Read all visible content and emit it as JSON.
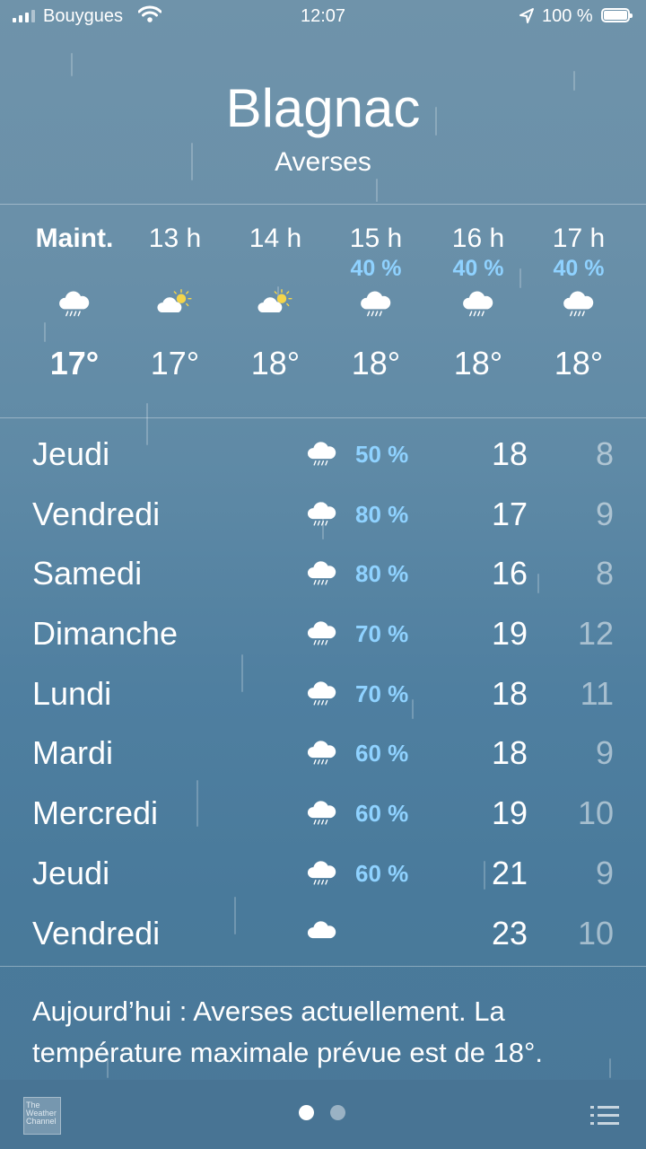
{
  "status_bar": {
    "carrier": "Bouygues",
    "time": "12:07",
    "battery": "100 %"
  },
  "location": {
    "city": "Blagnac",
    "condition": "Averses"
  },
  "hourly": [
    {
      "label": "Maint.",
      "pop": "",
      "icon": "rain-cloud-icon",
      "temp": "17°"
    },
    {
      "label": "13 h",
      "pop": "",
      "icon": "sun-cloud-icon",
      "temp": "17°"
    },
    {
      "label": "14 h",
      "pop": "",
      "icon": "sun-cloud-icon",
      "temp": "18°"
    },
    {
      "label": "15 h",
      "pop": "40 %",
      "icon": "rain-cloud-icon",
      "temp": "18°"
    },
    {
      "label": "16 h",
      "pop": "40 %",
      "icon": "rain-cloud-icon",
      "temp": "18°"
    },
    {
      "label": "17 h",
      "pop": "40 %",
      "icon": "rain-cloud-icon",
      "temp": "18°"
    }
  ],
  "daily": [
    {
      "day": "Jeudi",
      "icon": "rain-cloud-icon",
      "pop": "50 %",
      "high": "18",
      "low": "8"
    },
    {
      "day": "Vendredi",
      "icon": "rain-cloud-icon",
      "pop": "80 %",
      "high": "17",
      "low": "9"
    },
    {
      "day": "Samedi",
      "icon": "rain-cloud-icon",
      "pop": "80 %",
      "high": "16",
      "low": "8"
    },
    {
      "day": "Dimanche",
      "icon": "rain-cloud-icon",
      "pop": "70 %",
      "high": "19",
      "low": "12"
    },
    {
      "day": "Lundi",
      "icon": "rain-cloud-icon",
      "pop": "70 %",
      "high": "18",
      "low": "11"
    },
    {
      "day": "Mardi",
      "icon": "rain-cloud-icon",
      "pop": "60 %",
      "high": "18",
      "low": "9"
    },
    {
      "day": "Mercredi",
      "icon": "rain-cloud-icon",
      "pop": "60 %",
      "high": "19",
      "low": "10"
    },
    {
      "day": "Jeudi",
      "icon": "rain-cloud-icon",
      "pop": "60 %",
      "high": "21",
      "low": "9"
    },
    {
      "day": "Vendredi",
      "icon": "cloud-icon",
      "pop": "",
      "high": "23",
      "low": "10"
    }
  ],
  "summary": "Aujourd’hui : Averses actuellement. La température maximale prévue est de 18°.",
  "bottom_bar": {
    "logo_text": "The Weather Channel",
    "page_count": 2,
    "current_page": 1
  },
  "colors": {
    "precip_accent": "#8fd2ff",
    "sun": "#f5d54a"
  }
}
